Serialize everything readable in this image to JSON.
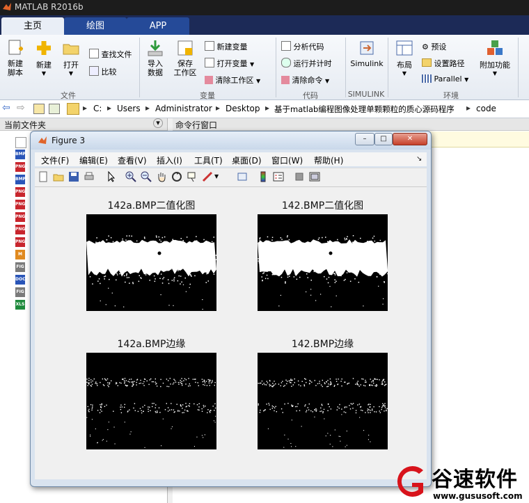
{
  "app": {
    "title": "MATLAB R2016b"
  },
  "tabs": [
    {
      "label": "主页"
    },
    {
      "label": "绘图"
    },
    {
      "label": "APP"
    }
  ],
  "ribbon": {
    "new_script": "新建\n脚本",
    "new": "新建",
    "open": "打开",
    "find_files": "查找文件",
    "compare": "比较",
    "import_data": "导入\n数据",
    "save_workspace": "保存\n工作区",
    "new_variable": "新建变量",
    "open_variable": "打开变量",
    "clear_workspace": "清除工作区",
    "analyze_code": "分析代码",
    "run_and_time": "运行并计时",
    "clear_commands": "清除命令",
    "simulink": "Simulink",
    "layout": "布局",
    "preferences": "预设",
    "set_path": "设置路径",
    "parallel": "Parallel",
    "addons": "附加功能",
    "sections": {
      "file": "文件",
      "variable": "变量",
      "code": "代码",
      "simulink": "SIMULINK",
      "environment": "环境"
    }
  },
  "address": {
    "crumbs": [
      "C:",
      "Users",
      "Administrator",
      "Desktop",
      "基于matlab编程图像处理单颗颗粒的质心源码程序",
      "code"
    ]
  },
  "left_panel": {
    "title": "当前文件夹",
    "files": [
      {
        "type": "blank"
      },
      {
        "type": "BMP"
      },
      {
        "type": "PNG"
      },
      {
        "type": "BMP"
      },
      {
        "type": "PNG"
      },
      {
        "type": "PNG"
      },
      {
        "type": "PNG"
      },
      {
        "type": "PNG"
      },
      {
        "type": "PNG"
      },
      {
        "type": "M"
      },
      {
        "type": "FIG"
      },
      {
        "type": "DOC"
      },
      {
        "type": "FIG"
      },
      {
        "type": "XLS"
      }
    ]
  },
  "command_panel": {
    "title": "命令行窗口"
  },
  "figure": {
    "title": "Figure 3",
    "menu": [
      "文件(F)",
      "编辑(E)",
      "查看(V)",
      "插入(I)",
      "工具(T)",
      "桌面(D)",
      "窗口(W)",
      "帮助(H)"
    ],
    "plots": [
      {
        "title": "142a.BMP二值化图",
        "kind": "binary"
      },
      {
        "title": "142.BMP二值化图",
        "kind": "binary"
      },
      {
        "title": "142a.BMP边缘",
        "kind": "edge"
      },
      {
        "title": "142.BMP边缘",
        "kind": "edge"
      }
    ]
  },
  "watermark": {
    "brand": "谷速软件",
    "url": "www.gususoft.com"
  }
}
